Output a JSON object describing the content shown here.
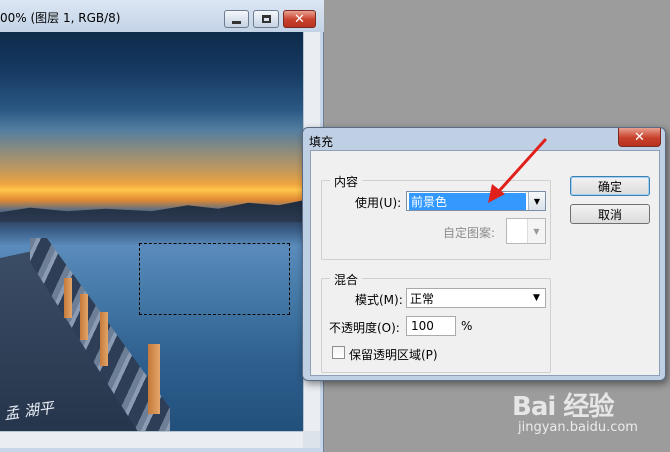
{
  "document": {
    "title": "00% (图层 1, RGB/8)",
    "signature": "孟 湖平"
  },
  "dialog": {
    "title": "填充",
    "content_group": {
      "legend": "内容",
      "use_label": "使用(U):",
      "use_value": "前景色",
      "custom_pattern_label": "自定图案:"
    },
    "blend_group": {
      "legend": "混合",
      "mode_label": "模式(M):",
      "mode_value": "正常",
      "opacity_label": "不透明度(O):",
      "opacity_value": "100",
      "opacity_unit": "%",
      "preserve_label": "保留透明区域(P)",
      "preserve_checked": false
    },
    "ok_label": "确定",
    "cancel_label": "取消"
  },
  "watermark": {
    "logo": "Bai 经验",
    "url": "jingyan.baidu.com"
  },
  "colors": {
    "annotation_arrow": "#e0201a",
    "selection_highlight": "#3399ff",
    "close_button": "#c7402b"
  }
}
